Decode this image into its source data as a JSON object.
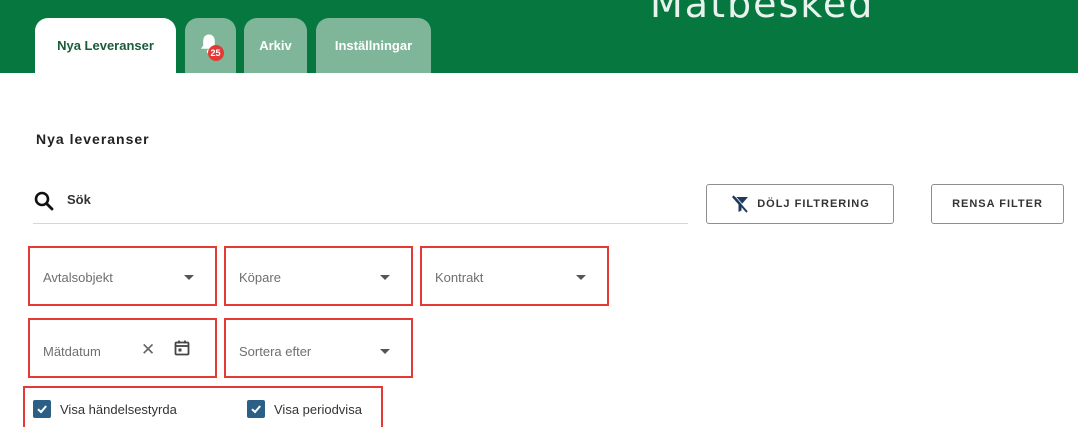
{
  "header": {
    "brand_title": "Mätbesked",
    "tabs": [
      {
        "label": "Nya Leveranser",
        "active": true
      },
      {
        "label": "",
        "icon": "bell-icon",
        "badge": "25"
      },
      {
        "label": "Arkiv"
      },
      {
        "label": "Inställningar"
      }
    ]
  },
  "page": {
    "title": "Nya leveranser"
  },
  "search": {
    "placeholder": "Sök"
  },
  "buttons": {
    "hide_filter": "DÖLJ FILTRERING",
    "clear_filter": "RENSA FILTER"
  },
  "filters": {
    "avtalsobjekt": "Avtalsobjekt",
    "kopare": "Köpare",
    "kontrakt": "Kontrakt",
    "matdatum": "Mätdatum",
    "sortera": "Sortera efter",
    "clear_symbol": "✕"
  },
  "checkboxes": [
    {
      "label": "Visa händelsestyrda",
      "checked": true
    },
    {
      "label": "Visa periodvisa",
      "checked": true
    }
  ],
  "colors": {
    "header_green": "#05773f",
    "tab_inactive": "#7fb699",
    "badge_red": "#e53935",
    "highlight_red": "#e53935",
    "checkbox_blue": "#2c5f86"
  }
}
